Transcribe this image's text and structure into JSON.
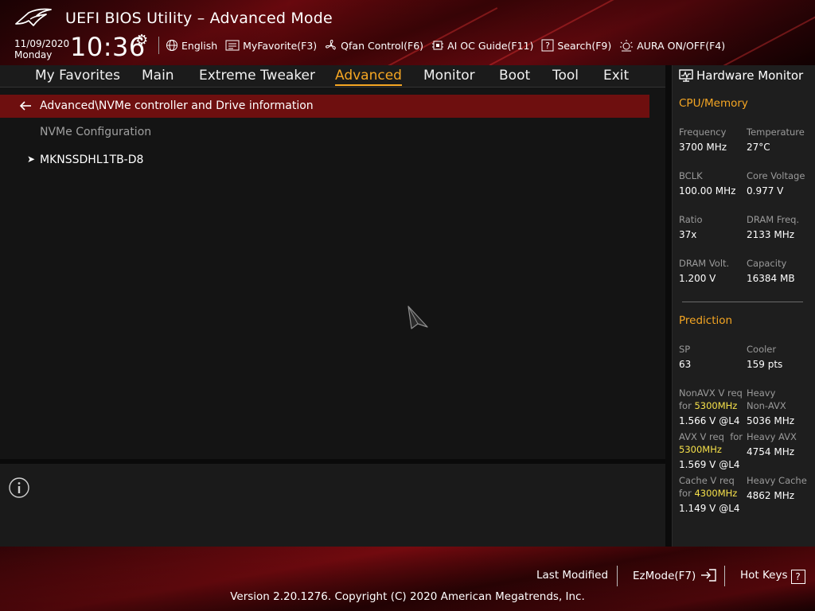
{
  "header": {
    "title": "UEFI BIOS Utility – Advanced Mode",
    "date": "11/09/2020",
    "day": "Monday",
    "time": "10:36",
    "toolbar": [
      {
        "label": "English",
        "icon": "globe-icon"
      },
      {
        "label": "MyFavorite(F3)",
        "icon": "favorite-list-icon"
      },
      {
        "label": "Qfan Control(F6)",
        "icon": "fan-icon"
      },
      {
        "label": "AI OC Guide(F11)",
        "icon": "chip-icon"
      },
      {
        "label": "Search(F9)",
        "icon": "question-icon"
      },
      {
        "label": "AURA ON/OFF(F4)",
        "icon": "light-icon"
      }
    ]
  },
  "menu": {
    "items": [
      "My Favorites",
      "Main",
      "Extreme Tweaker",
      "Advanced",
      "Monitor",
      "Boot",
      "Tool",
      "Exit"
    ],
    "active": "Advanced"
  },
  "main": {
    "path": "Advanced\\NVMe controller and Drive information",
    "section": "NVMe Configuration",
    "drive": "MKNSSDHL1TB-D8"
  },
  "hw": {
    "title": "Hardware Monitor",
    "cpu_title": "CPU/Memory",
    "cpu": {
      "freq_label": "Frequency",
      "freq": "3700 MHz",
      "temp_label": "Temperature",
      "temp": "27°C",
      "bclk_label": "BCLK",
      "bclk": "100.00 MHz",
      "vcore_label": "Core Voltage",
      "vcore": "0.977 V",
      "ratio_label": "Ratio",
      "ratio": "37x",
      "dramf_label": "DRAM Freq.",
      "dramf": "2133 MHz",
      "dramv_label": "DRAM Volt.",
      "dramv": "1.200 V",
      "cap_label": "Capacity",
      "cap": "16384 MB"
    },
    "pred_title": "Prediction",
    "pred": {
      "sp_label": "SP",
      "sp": "63",
      "cooler_label": "Cooler",
      "cooler": "159 pts",
      "nonavx_label": "NonAVX V req",
      "nonavx_for": "for",
      "nonavx_freq": "5300MHz",
      "nonavx_val": "1.566 V @L4",
      "heavy_nonavx_label1": "Heavy",
      "heavy_nonavx_label2": "Non-AVX",
      "heavy_nonavx_val": "5036 MHz",
      "avx_label": "AVX V req",
      "avx_for": "for",
      "avx_freq": "5300MHz",
      "avx_val": "1.569 V @L4",
      "heavy_avx_label": "Heavy AVX",
      "heavy_avx_val": "4754 MHz",
      "cache_label": "Cache V req",
      "cache_for": "for",
      "cache_freq": "4300MHz",
      "cache_val": "1.149 V @L4",
      "heavy_cache_label": "Heavy Cache",
      "heavy_cache_val": "4862 MHz"
    }
  },
  "footer": {
    "last_modified": "Last Modified",
    "ezmode": "EzMode(F7)",
    "hotkeys": "Hot Keys",
    "hotkeys_key": "?",
    "version": "Version 2.20.1276. Copyright (C) 2020 American Megatrends, Inc."
  },
  "colors": {
    "accent": "#f5a623",
    "highlight_freq": "#f5e04a",
    "path_bar": "#6e0f0f",
    "brand_red": "#8a0c12"
  }
}
